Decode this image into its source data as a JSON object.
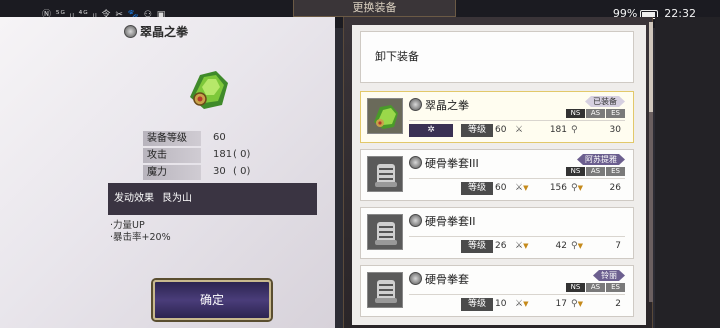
{
  "status_bar": {
    "left_indicators": "Ⓝ ⁵ᴳ ᵢₗ ⁴ᴳ ᵢₗ 令 ✂ 🐾 ⚇ ▣",
    "battery": "99%",
    "time": "22:32"
  },
  "title": "更换装备",
  "detail": {
    "name": "翠晶之拳",
    "stats": [
      {
        "label": "装备等级",
        "value": "60",
        "paren": ""
      },
      {
        "label": "攻击",
        "value": "181",
        "paren": "(      0)"
      },
      {
        "label": "魔力",
        "value": "30",
        "paren": "(      0)"
      }
    ],
    "effect_label": "发动效果",
    "effect_value": "艮为山",
    "bullets": [
      "·力量UP",
      "·暴击率+20%"
    ],
    "confirm_label": "确定"
  },
  "list": {
    "unequip_label": "卸下装备",
    "items": [
      {
        "name": "翠晶之拳",
        "tag": "已装备",
        "level_label": "等级",
        "level": "60",
        "attack": "181",
        "magic": "30",
        "gear_mark": "✲",
        "attack_down": false,
        "magic_down": false,
        "sockets": [
          "NS",
          "AS",
          "ES"
        ]
      },
      {
        "name": "硬骨拳套III",
        "tag": "阿苏提雅",
        "level_label": "等级",
        "level": "60",
        "attack": "156",
        "magic": "26",
        "gear_mark": "",
        "attack_down": true,
        "magic_down": true,
        "sockets": [
          "NS",
          "AS",
          "ES"
        ]
      },
      {
        "name": "硬骨拳套II",
        "tag": "",
        "level_label": "等级",
        "level": "26",
        "attack": "42",
        "magic": "7",
        "gear_mark": "",
        "attack_down": true,
        "magic_down": true,
        "sockets": []
      },
      {
        "name": "硬骨拳套",
        "tag": "铃丽",
        "level_label": "等级",
        "level": "10",
        "attack": "17",
        "magic": "2",
        "gear_mark": "",
        "attack_down": true,
        "magic_down": true,
        "sockets": [
          "NS",
          "AS",
          "ES"
        ]
      }
    ]
  },
  "icons": {
    "item_coin": "coin-icon",
    "attack": "sword-icon",
    "magic": "wand-icon",
    "down": "down-arrow-icon"
  },
  "colors": {
    "accent_purple": "#3a3154",
    "selected_border": "#e2c86a",
    "down_arrow": "#c58a1b"
  }
}
